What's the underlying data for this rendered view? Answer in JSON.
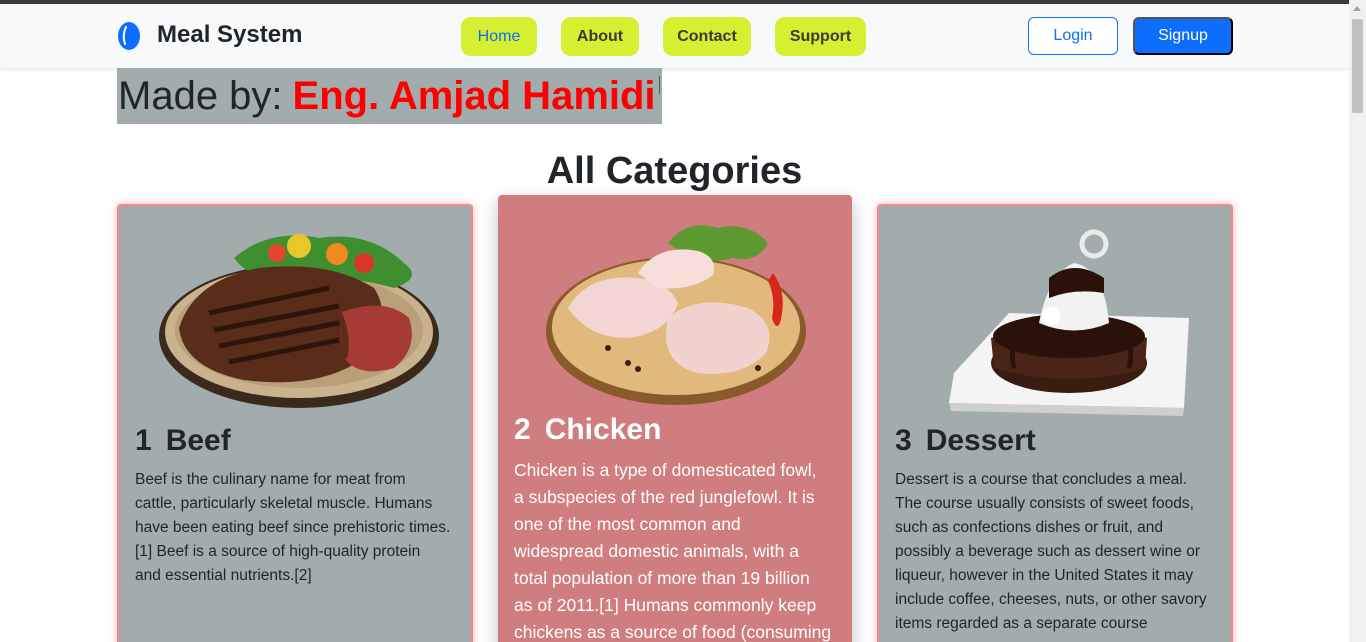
{
  "navbar": {
    "brand": "Meal System",
    "links": [
      {
        "label": "Home",
        "active": true
      },
      {
        "label": "About"
      },
      {
        "label": "Contact"
      },
      {
        "label": "Support"
      }
    ],
    "login_label": "Login",
    "signup_label": "Signup"
  },
  "credit": {
    "label": "Made by:",
    "name": "Eng. Amjad Hamidi"
  },
  "section_title": "All Categories",
  "cards": [
    {
      "number": "1",
      "title": "Beef",
      "image": "beef-steak-plate",
      "description_lines": [
        "Beef is the culinary name for meat from",
        "cattle, particularly skeletal muscle. Humans",
        "have been eating beef since prehistoric times.",
        "[1] Beef is a source of high-quality protein",
        "and essential nutrients.[2]"
      ]
    },
    {
      "number": "2",
      "title": "Chicken",
      "image": "raw-chicken-board",
      "description_lines": [
        "Chicken is a type of domesticated fowl,",
        "a subspecies of the red junglefowl. It is",
        "one of the most common and",
        "widespread domestic animals, with a",
        "total population of more than 19 billion",
        "as of 2011.[1] Humans commonly keep",
        "chickens as a source of food (consuming"
      ]
    },
    {
      "number": "3",
      "title": "Dessert",
      "image": "chocolate-cake-plate",
      "description_lines": [
        "Dessert is a course that concludes a meal.",
        "The course usually consists of sweet foods,",
        "such as confections dishes or fruit, and",
        "possibly a beverage such as dessert wine or",
        "liqueur, however in the United States it may",
        "include coffee, cheeses, nuts, or other savory",
        "items regarded as a separate course"
      ]
    }
  ],
  "colors": {
    "nav_button": "#d6ef31",
    "primary": "#0d6efd",
    "card_bg": "#a3acac",
    "card_highlight": "#cf7d7f",
    "credit_name": "#ff0000"
  }
}
